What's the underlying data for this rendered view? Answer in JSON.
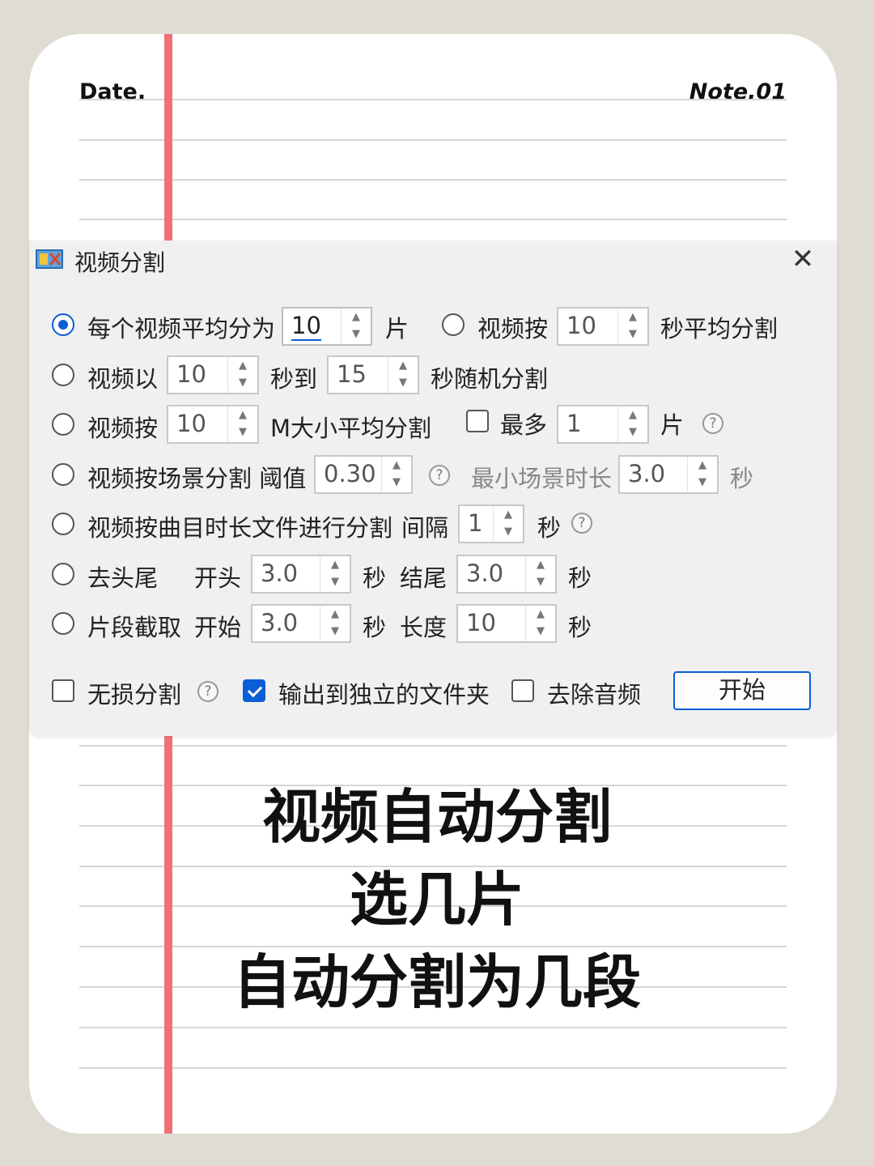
{
  "notebook": {
    "date_label": "Date.",
    "note_label": "Note.01"
  },
  "dialog": {
    "title": "视频分割",
    "close_glyph": "✕",
    "rows": {
      "r1": {
        "prefix": "每个视频平均分为",
        "value": "10",
        "unit": "片",
        "opt2_label": "视频按",
        "opt2_value": "10",
        "opt2_suffix": "秒平均分割"
      },
      "r2": {
        "prefix": "视频以",
        "value_from": "10",
        "mid": "秒到",
        "value_to": "15",
        "suffix": "秒随机分割"
      },
      "r3": {
        "prefix": "视频按",
        "value": "10",
        "mid": "M大小平均分割",
        "max_label": "最多",
        "max_value": "1",
        "max_unit": "片"
      },
      "r4": {
        "prefix": "视频按场景分割 阈值",
        "threshold": "0.30",
        "min_label": "最小场景时长",
        "min_value": "3.0",
        "min_unit": "秒"
      },
      "r5": {
        "prefix": "视频按曲目时长文件进行分割",
        "interval_label": "间隔",
        "interval_value": "1",
        "interval_unit": "秒"
      },
      "r6": {
        "prefix": "去头尾",
        "head_label": "开头",
        "head_value": "3.0",
        "head_unit": "秒",
        "tail_label": "结尾",
        "tail_value": "3.0",
        "tail_unit": "秒"
      },
      "r7": {
        "prefix": "片段截取",
        "start_label": "开始",
        "start_value": "3.0",
        "start_unit": "秒",
        "len_label": "长度",
        "len_value": "10",
        "len_unit": "秒"
      }
    },
    "footer": {
      "lossless_label": "无损分割",
      "output_folder_label": "输出到独立的文件夹",
      "remove_audio_label": "去除音频",
      "start_button": "开始"
    },
    "selected_option": "r1",
    "checked": {
      "lossless": false,
      "output_folder": true,
      "remove_audio": false,
      "max_pieces": false
    }
  },
  "caption": {
    "line1": "视频自动分割",
    "line2": "选几片",
    "line3": "自动分割为几段"
  },
  "colors": {
    "accent": "#0a5fd6",
    "margin_line": "#ef7177",
    "background": "#dedcd3"
  }
}
